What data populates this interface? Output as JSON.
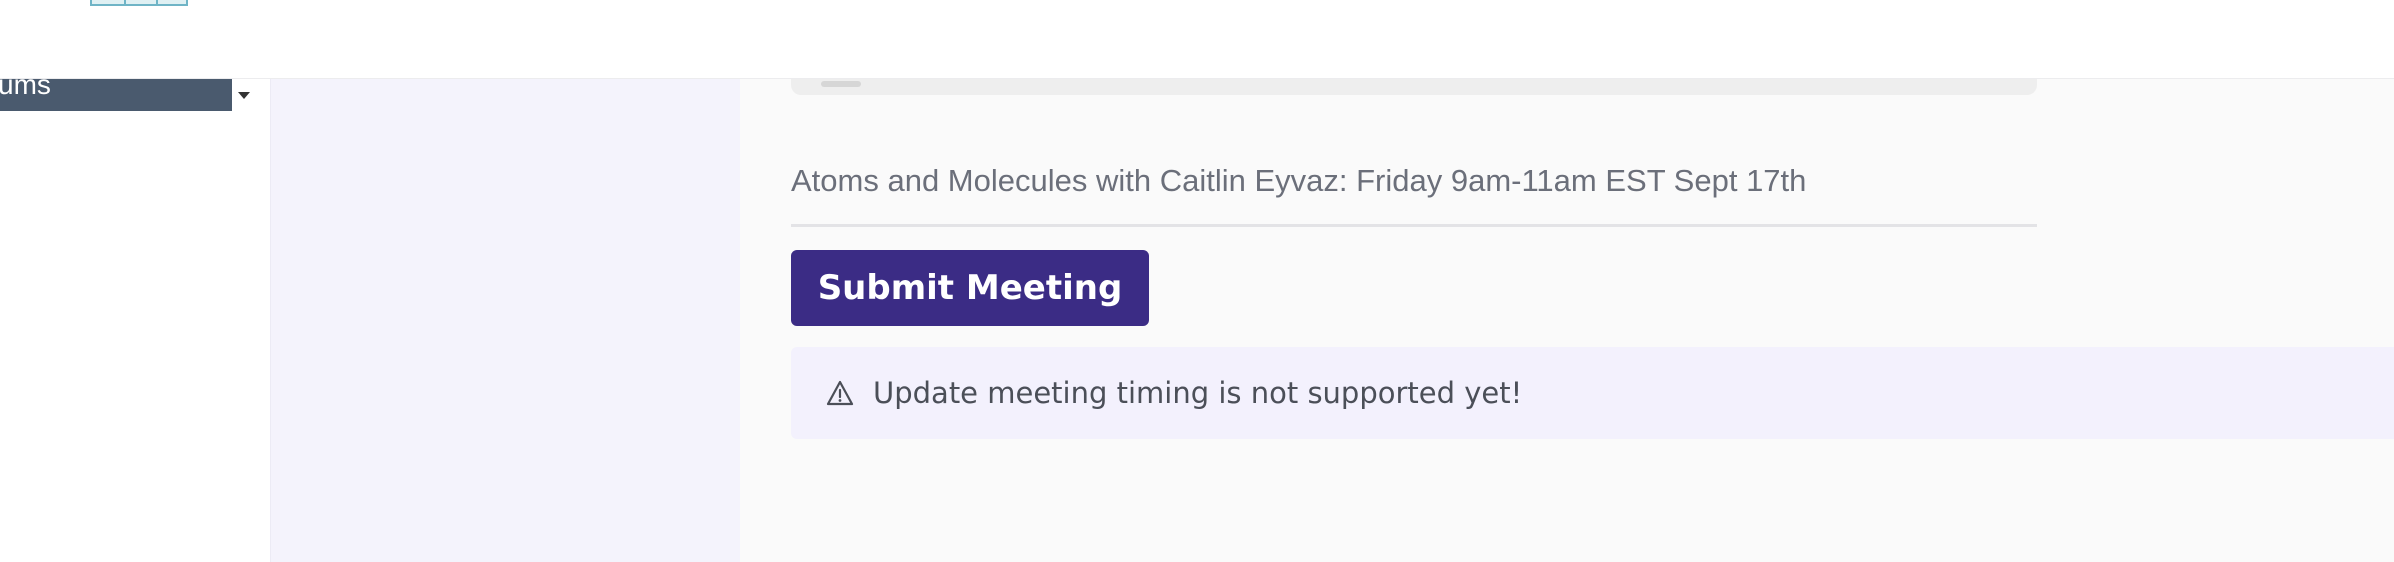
{
  "sidebar": {
    "select_text": "ums"
  },
  "meeting": {
    "summary": "Atoms and Molecules with Caitlin Eyvaz: Friday 9am-11am EST Sept 17th"
  },
  "actions": {
    "submit_label": "Submit Meeting"
  },
  "notice": {
    "icon": "warning-triangle-icon",
    "text": "Update meeting timing is not supported yet!"
  },
  "colors": {
    "accent": "#3b2c85",
    "sidebar_select": "#4a5a6e",
    "panel": "#f4f3fc",
    "notice_bg": "#f3f1fd"
  }
}
